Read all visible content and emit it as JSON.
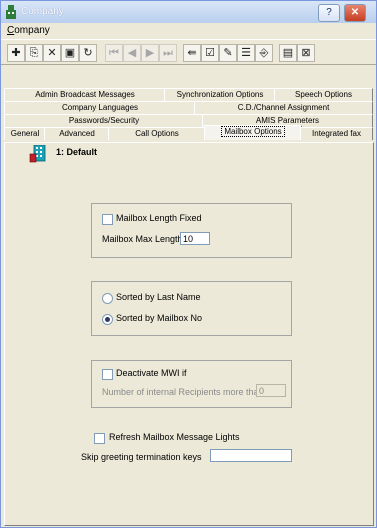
{
  "window": {
    "title": "Company",
    "help_btn": "?",
    "close_btn": "✕"
  },
  "menu": {
    "items": [
      {
        "label": "Company",
        "mnemonic": "C",
        "rest": "ompany"
      }
    ]
  },
  "toolbar": {
    "buttons": [
      {
        "icon": "add-icon",
        "glyph": "✚",
        "enabled": true
      },
      {
        "icon": "copy-icon",
        "glyph": "⎘",
        "enabled": true
      },
      {
        "icon": "delete-icon",
        "glyph": "✕",
        "enabled": true
      },
      {
        "icon": "save-icon",
        "glyph": "▣",
        "enabled": true
      },
      {
        "icon": "refresh-icon",
        "glyph": "↻",
        "enabled": true
      },
      {
        "icon": "first-record-icon",
        "glyph": "⏮",
        "enabled": false
      },
      {
        "icon": "previous-record-icon",
        "glyph": "◀",
        "enabled": false
      },
      {
        "icon": "next-record-icon",
        "glyph": "▶",
        "enabled": false
      },
      {
        "icon": "last-record-icon",
        "glyph": "⏭",
        "enabled": false
      },
      {
        "icon": "find-icon",
        "glyph": "⇚",
        "enabled": true
      },
      {
        "icon": "checklist-icon",
        "glyph": "☑",
        "enabled": true
      },
      {
        "icon": "edit-icon",
        "glyph": "✎",
        "enabled": true
      },
      {
        "icon": "properties-icon",
        "glyph": "☰",
        "enabled": true
      },
      {
        "icon": "import-icon",
        "glyph": "⎆",
        "enabled": true
      },
      {
        "icon": "report-icon",
        "glyph": "▤",
        "enabled": true
      },
      {
        "icon": "exit-icon",
        "glyph": "⊠",
        "enabled": true
      }
    ]
  },
  "tabs": {
    "row1": [
      {
        "label": "Admin Broadcast Messages"
      },
      {
        "label": "Synchronization Options"
      },
      {
        "label": "Speech Options"
      }
    ],
    "row2": [
      {
        "label": "Company Languages"
      },
      {
        "label": "C.D./Channel Assignment"
      }
    ],
    "row3": [
      {
        "label": "Passwords/Security"
      },
      {
        "label": "AMIS Parameters"
      }
    ],
    "row4": [
      {
        "label": "General"
      },
      {
        "label": "Advanced"
      },
      {
        "label": "Call Options"
      },
      {
        "label": "Mailbox Options",
        "selected": true
      },
      {
        "label": "Integrated fax"
      }
    ]
  },
  "record": {
    "label": "1: Default"
  },
  "mailbox_length": {
    "fixed_label": "Mailbox Length Fixed",
    "fixed_checked": false,
    "max_label": "Mailbox Max Length",
    "max_value": "10"
  },
  "sort": {
    "options": [
      {
        "label": "Sorted by Last Name",
        "selected": false
      },
      {
        "label": "Sorted by Mailbox No",
        "selected": true
      }
    ]
  },
  "mwi": {
    "deactivate_label": "Deactivate MWI if",
    "deactivate_checked": false,
    "recipients_label": "Number of internal Recipients more than",
    "recipients_value": "0"
  },
  "refresh_lights": {
    "label": "Refresh Mailbox Message Lights",
    "checked": false
  },
  "skip_keys": {
    "label": "Skip greeting termination keys",
    "value": ""
  },
  "colors": {
    "accent": "#1a2e5a",
    "titlebar_top": "#d9e6f7",
    "close_btn": "#c63f23"
  }
}
